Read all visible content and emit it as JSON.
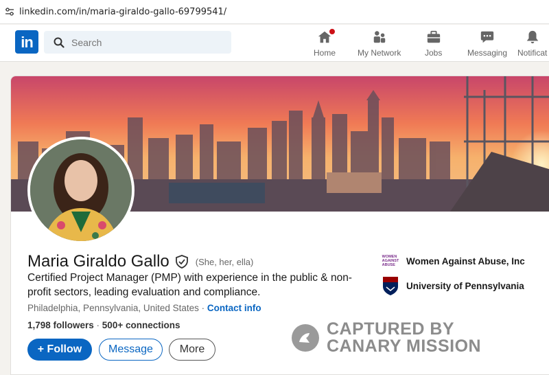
{
  "browser": {
    "url": "linkedin.com/in/maria-giraldo-gallo-69799541/"
  },
  "nav": {
    "logo": "in",
    "search_placeholder": "Search",
    "items": [
      {
        "label": "Home",
        "icon": "home-icon"
      },
      {
        "label": "My Network",
        "icon": "network-icon"
      },
      {
        "label": "Jobs",
        "icon": "briefcase-icon"
      },
      {
        "label": "Messaging",
        "icon": "messaging-icon"
      },
      {
        "label": "Notificat",
        "icon": "bell-icon"
      }
    ]
  },
  "profile": {
    "name": "Maria Giraldo Gallo",
    "pronouns": "(She, her, ella)",
    "headline": "Certified Project Manager (PMP) with experience in the public & non-profit sectors, leading evaluation and compliance.",
    "location": "Philadelphia, Pennsylvania, United States",
    "location_sep": " · ",
    "contact_link": "Contact info",
    "followers": "1,798 followers",
    "conn_sep": " · ",
    "connections": "500+ connections",
    "organizations": [
      {
        "name": "Women Against Abuse, Inc",
        "logo_text": "WOMEN AGAINST ABUSE"
      },
      {
        "name": "University of Pennsylvania"
      }
    ]
  },
  "actions": {
    "follow": "+ Follow",
    "message": "Message",
    "more": "More"
  },
  "watermark": {
    "line1": "CAPTURED BY",
    "line2": "CANARY MISSION"
  },
  "colors": {
    "accent": "#0a66c2",
    "badge": "#cc1016",
    "watermark": "#8c8c8c"
  }
}
